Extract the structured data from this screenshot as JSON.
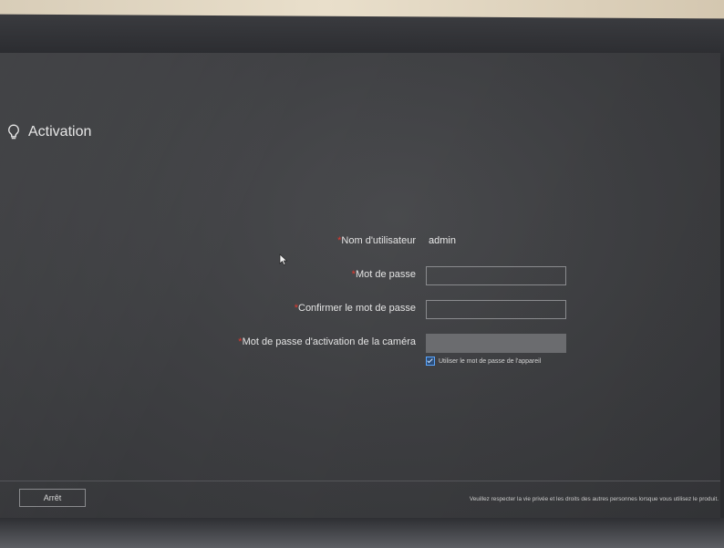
{
  "header": {
    "title": "Activation",
    "icon": "lightbulb-icon"
  },
  "form": {
    "username": {
      "required_mark": "*",
      "label": "Nom d'utilisateur",
      "value": "admin"
    },
    "password": {
      "required_mark": "*",
      "label": "Mot de passe",
      "value": ""
    },
    "confirm_password": {
      "required_mark": "*",
      "label": "Confirmer le mot de passe",
      "value": ""
    },
    "camera_password": {
      "required_mark": "*",
      "label": "Mot de passe d'activation de la caméra",
      "value": ""
    },
    "use_device_password": {
      "label": "Utiliser le mot de passe de l'appareil",
      "checked": true
    }
  },
  "footer": {
    "stop_label": "Arrêt",
    "notice": "Veuillez respecter la vie privée et les droits des autres personnes lorsque vous utilisez le produit."
  },
  "colors": {
    "background": "#3f4043",
    "required": "#e0392e",
    "checkbox_accent": "#5aa7ff"
  }
}
